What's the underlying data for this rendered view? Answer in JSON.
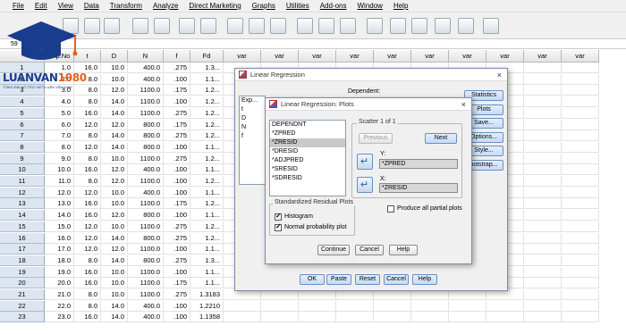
{
  "menu": [
    "File",
    "Edit",
    "View",
    "Data",
    "Transform",
    "Analyze",
    "Direct Marketing",
    "Graphs",
    "Utilities",
    "Add-ons",
    "Window",
    "Help"
  ],
  "cell_ref": "59",
  "logo": {
    "brand": "LUANVAN",
    "accent": "1080",
    "tagline": "TỔNG ĐÀI HỖ TRỢ VIẾT LUẬN VĂN 1080"
  },
  "columns": [
    "Exp.No",
    "t",
    "D",
    "N",
    "f",
    "Fd",
    "var",
    "var",
    "var",
    "var",
    "var",
    "var",
    "var",
    "var",
    "var",
    "var"
  ],
  "rows": [
    {
      "n": "1",
      "c": [
        "1.0",
        "16.0",
        "10.0",
        "400.0",
        ".275",
        "1.3..."
      ]
    },
    {
      "n": "2",
      "c": [
        "2.0",
        "8.0",
        "10.0",
        "400.0",
        ".100",
        "1.1..."
      ]
    },
    {
      "n": "3",
      "c": [
        "3.0",
        "8.0",
        "12.0",
        "1100.0",
        ".175",
        "1.2..."
      ]
    },
    {
      "n": "4",
      "c": [
        "4.0",
        "8.0",
        "14.0",
        "1100.0",
        ".100",
        "1.2..."
      ]
    },
    {
      "n": "5",
      "c": [
        "5.0",
        "16.0",
        "14.0",
        "1100.0",
        ".275",
        "1.2..."
      ]
    },
    {
      "n": "6",
      "c": [
        "6.0",
        "12.0",
        "12.0",
        "800.0",
        ".175",
        "1.2..."
      ]
    },
    {
      "n": "7",
      "c": [
        "7.0",
        "8.0",
        "14.0",
        "800.0",
        ".275",
        "1.2..."
      ]
    },
    {
      "n": "8",
      "c": [
        "8.0",
        "12.0",
        "14.0",
        "800.0",
        ".100",
        "1.1..."
      ]
    },
    {
      "n": "9",
      "c": [
        "9.0",
        "8.0",
        "10.0",
        "1100.0",
        ".275",
        "1.2..."
      ]
    },
    {
      "n": "10",
      "c": [
        "10.0",
        "16.0",
        "12.0",
        "400.0",
        ".100",
        "1.1..."
      ]
    },
    {
      "n": "11",
      "c": [
        "11.0",
        "8.0",
        "12.0",
        "1100.0",
        ".100",
        "1.2..."
      ]
    },
    {
      "n": "12",
      "c": [
        "12.0",
        "12.0",
        "10.0",
        "400.0",
        ".100",
        "1.1..."
      ]
    },
    {
      "n": "13",
      "c": [
        "13.0",
        "16.0",
        "10.0",
        "1100.0",
        ".175",
        "1.2..."
      ]
    },
    {
      "n": "14",
      "c": [
        "14.0",
        "16.0",
        "12.0",
        "800.0",
        ".100",
        "1.1..."
      ]
    },
    {
      "n": "15",
      "c": [
        "15.0",
        "12.0",
        "10.0",
        "1100.0",
        ".275",
        "1.2..."
      ]
    },
    {
      "n": "16",
      "c": [
        "16.0",
        "12.0",
        "14.0",
        "800.0",
        ".275",
        "1.2..."
      ]
    },
    {
      "n": "17",
      "c": [
        "17.0",
        "12.0",
        "12.0",
        "1100.0",
        ".100",
        "1.1..."
      ]
    },
    {
      "n": "18",
      "c": [
        "18.0",
        "8.0",
        "14.0",
        "800.0",
        ".275",
        "1.3..."
      ]
    },
    {
      "n": "19",
      "c": [
        "19.0",
        "16.0",
        "10.0",
        "1100.0",
        ".100",
        "1.1..."
      ]
    },
    {
      "n": "20",
      "c": [
        "20.0",
        "16.0",
        "10.0",
        "1100.0",
        ".175",
        "1.1..."
      ]
    },
    {
      "n": "21",
      "c": [
        "21.0",
        "8.0",
        "10.0",
        "1100.0",
        ".275",
        "1.3183"
      ]
    },
    {
      "n": "22",
      "c": [
        "22.0",
        "8.0",
        "14.0",
        "400.0",
        ".100",
        "1.2210"
      ]
    },
    {
      "n": "23",
      "c": [
        "23.0",
        "16.0",
        "14.0",
        "400.0",
        ".100",
        "1.1358"
      ]
    }
  ],
  "linreg": {
    "title": "Linear Regression",
    "dependent_label": "Dependent:",
    "vars": [
      "Exp...",
      "t",
      "D",
      "N",
      "f"
    ],
    "side_buttons": [
      "Statistics...",
      "Plots...",
      "Save...",
      "Options...",
      "Style...",
      "Bootstrap..."
    ],
    "side_buttons_shown": [
      "Statistics",
      "Plots",
      "Save...",
      "Options...",
      "Style...",
      "ootstrap..."
    ],
    "bottom_buttons": [
      "OK",
      "Paste",
      "Reset",
      "Cancel",
      "Help"
    ]
  },
  "plots": {
    "title": "Linear Regression: Plots",
    "source_vars": [
      "DEPENDNT",
      "*ZPRED",
      "*ZRESID",
      "*DRESID",
      "*ADJPRED",
      "*SRESID",
      "*SDRESID"
    ],
    "selected_index": 2,
    "scatter_label": "Scatter 1 of 1",
    "previous": "Previous",
    "next": "Next",
    "y_label": "Y:",
    "y_value": "*ZPRED",
    "x_label": "X:",
    "x_value": "*ZRESID",
    "std_group": "Standardized Residual Plots",
    "histogram": "Histogram",
    "histogram_checked": true,
    "normal_plot": "Normal probability plot",
    "normal_plot_checked": true,
    "partial": "Produce all partial plots",
    "partial_checked": false,
    "continue": "Continue",
    "cancel": "Cancel",
    "help": "Help"
  }
}
